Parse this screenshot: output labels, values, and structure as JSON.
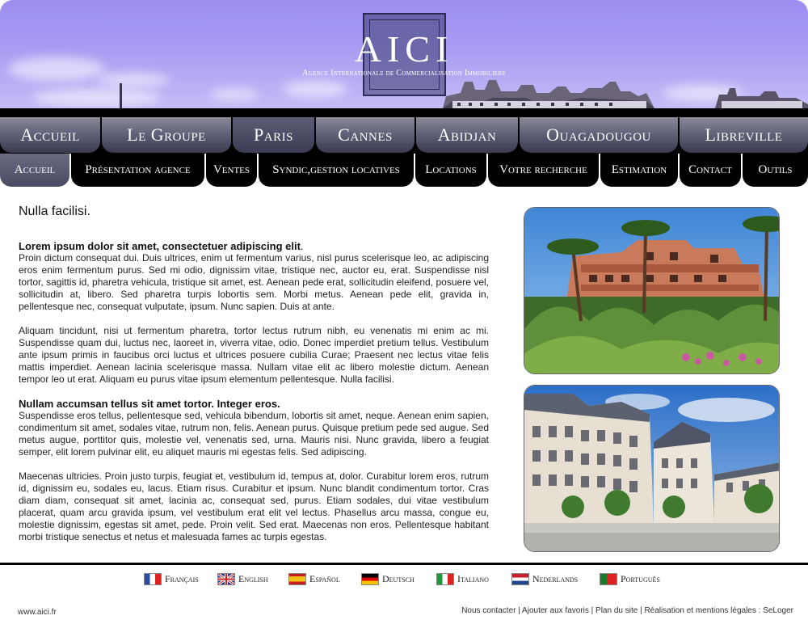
{
  "header": {
    "logo": "AICI",
    "tagline": "Agence Internationale de Commercialisation Immobiliere"
  },
  "main_nav": [
    "Accueil",
    "Le Groupe",
    "Paris",
    "Cannes",
    "Abidjan",
    "Ouagadougou",
    "Libreville"
  ],
  "main_nav_active": "Paris",
  "sub_nav": [
    "Accueil",
    "Présentation agence",
    "Ventes",
    "Syndic,gestion locatives",
    "Locations",
    "Votre recherche",
    "Estimation",
    "Contact",
    "Outils"
  ],
  "sub_nav_active": "Accueil",
  "content": {
    "title": "Nulla facilisi.",
    "heading1": "Lorem ipsum dolor sit amet, consectetuer adipiscing elit",
    "heading1_suffix": ".",
    "p1": "Proin dictum consequat dui. Duis ultrices, enim ut fermentum varius, nisl purus scelerisque leo, ac adipiscing eros enim fermentum purus. Sed mi odio, dignissim vitae, tristique nec, auctor eu, erat. Suspendisse nisl tortor, sagittis id, pharetra vehicula, tristique sit amet, est. Aenean pede erat, sollicitudin eleifend, posuere vel, sollicitudin at, libero. Sed pharetra turpis lobortis sem. Morbi metus. Aenean pede elit, gravida in, pellentesque nec, consequat vulputate, ipsum. Nunc sapien. Duis at ante.",
    "p2": "Aliquam tincidunt, nisi ut fermentum pharetra, tortor lectus rutrum nibh, eu venenatis mi enim ac mi. Suspendisse quam dui, luctus nec, laoreet in, viverra vitae, odio. Donec imperdiet pretium tellus. Vestibulum ante ipsum primis in faucibus orci luctus et ultrices posuere cubilia Curae; Praesent nec lectus vitae felis mattis imperdiet. Aenean lacinia scelerisque massa. Nullam vitae elit ac libero molestie dictum. Aenean tempor leo ut erat. Aliquam eu purus vitae ipsum elementum pellentesque. Nulla facilisi.",
    "heading2": "Nullam accumsan tellus sit amet tortor. Integer eros.",
    "p3": " Suspendisse eros tellus, pellentesque sed, vehicula bibendum, lobortis sit amet, neque. Aenean enim sapien, condimentum sit amet, sodales vitae, rutrum non, felis. Aenean purus. Quisque pretium pede sed augue. Sed metus augue, porttitor quis, molestie vel, venenatis sed, urna. Mauris nisi. Nunc gravida, libero a feugiat semper, elit lorem pulvinar elit, eu aliquet mauris mi egestas felis. Sed adipiscing.",
    "p4": "Maecenas ultricies. Proin justo turpis, feugiat et, vestibulum id, tempus at, dolor. Curabitur lorem eros, rutrum id, dignissim eu, sodales eu, lacus. Etiam risus. Curabitur et ipsum. Nunc blandit condimentum tortor. Cras diam diam, consequat sit amet, lacinia ac, consequat sed, purus. Etiam sodales, dui vitae vestibulum placerat, quam arcu gravida ipsum, vel vestibulum erat elit vel lectus. Phasellus arcu massa, congue eu, molestie dignissim, egestas sit amet, pede. Proin velit. Sed erat. Maecenas non eros. Pellentesque habitant morbi tristique senectus et netus et malesuada fames ac turpis egestas."
  },
  "languages": [
    "Français",
    "English",
    "Español",
    "Deutsch",
    "Italiano",
    "Nederlands",
    "Português"
  ],
  "footer": {
    "site": "www.aici.fr",
    "links": "Nous contacter | Ajouter aux favoris | Plan du site | Réalisation et mentions légales : SeLoger"
  },
  "colors": {
    "banner": "#a89cf3",
    "nav": "#62627a",
    "black": "#000000"
  }
}
